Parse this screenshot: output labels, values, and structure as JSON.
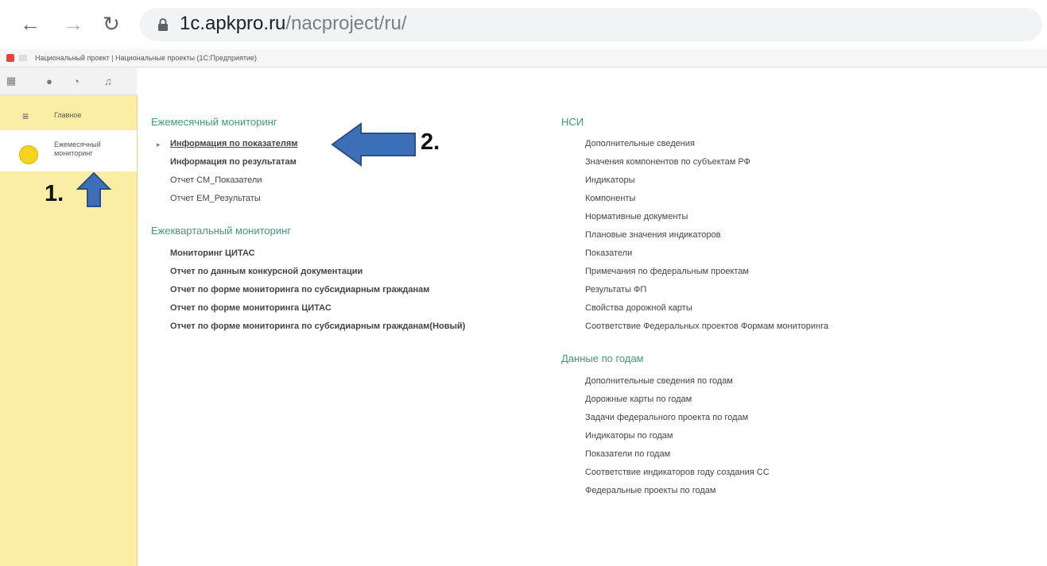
{
  "browser": {
    "url_host": "1c.apkpro.ru",
    "url_path": "/nacproject/ru/"
  },
  "titlebar": {
    "crumbs": "Национальный проект | Национальные проекты (1С:Предприятие)"
  },
  "sidebar": {
    "items": [
      {
        "label": "Главное"
      },
      {
        "label": "Ежемесячный мониторинг"
      }
    ]
  },
  "annotations": {
    "step1": "1.",
    "step2": "2."
  },
  "left_column": {
    "sections": [
      {
        "title": "Ежемесячный мониторинг",
        "links": [
          "Информация по показателям",
          "Информация по результатам",
          "Отчет СМ_Показатели",
          "Отчет ЕМ_Результаты"
        ]
      },
      {
        "title": "Ежеквартальный мониторинг",
        "links": [
          "Мониторинг ЦИТАС",
          "Отчет по данным конкурсной документации",
          "Отчет по форме мониторинга по субсидиарным гражданам",
          "Отчет по форме мониторинга ЦИТАС",
          "Отчет по форме мониторинга по субсидиарным гражданам(Новый)"
        ]
      }
    ]
  },
  "right_column": {
    "sections": [
      {
        "title": "НСИ",
        "links": [
          "Дополнительные сведения",
          "Значения компонентов по субъектам РФ",
          "Индикаторы",
          "Компоненты",
          "Нормативные документы",
          "Плановые значения индикаторов",
          "Показатели",
          "Примечания по федеральным проектам",
          "Результаты ФП",
          "Свойства дорожной карты",
          "Соответствие Федеральных проектов Формам мониторинга"
        ]
      },
      {
        "title": "Данные по годам",
        "links": [
          "Дополнительные сведения по годам",
          "Дорожные карты по годам",
          "Задачи федерального проекта по годам",
          "Индикаторы по годам",
          "Показатели по годам",
          "Соответствие индикаторов году создания СС",
          "Федеральные проекты по годам"
        ]
      }
    ]
  },
  "colors": {
    "sidebar_bg": "#fbeda3",
    "section_title": "#3f9a7a",
    "arrow_fill": "#3c6fb8",
    "arrow_stroke": "#2a4f86"
  },
  "icons": [
    "back-arrow-icon",
    "forward-arrow-icon",
    "reload-icon",
    "lock-icon",
    "grid-icon",
    "star-icon",
    "history-icon",
    "bell-icon",
    "hamburger-icon",
    "coin-icon"
  ]
}
